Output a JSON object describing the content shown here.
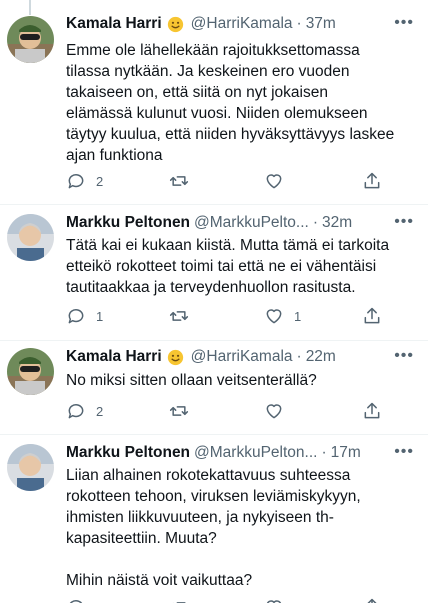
{
  "tweets": [
    {
      "name": "Kamala Harri",
      "handle": "@HarriKamala",
      "time": "37m",
      "text": "Emme ole lähellekään rajoitukksettomassa\ntilassa nytkään. Ja keskeinen ero vuoden\ntakaiseen on, että siitä on nyt jokaisen\nelämässä kulunut vuosi. Niiden olemukseen\ntäytyy kuulua, että niiden hyväksyttävyys laskee\najan funktiona",
      "replies": "2",
      "retweets": "",
      "likes": "",
      "has_emoji": true
    },
    {
      "name": "Markku Peltonen",
      "handle": "@MarkkuPelto...",
      "time": "32m",
      "text": "Tätä kai ei kukaan kiistä. Mutta tämä ei tarkoita\netteikö rokotteet toimi tai että ne ei vähentäisi\ntautitaakkaa ja terveydenhuollon rasitusta.",
      "replies": "1",
      "retweets": "",
      "likes": "1",
      "has_emoji": false
    },
    {
      "name": "Kamala Harri",
      "handle": "@HarriKamala",
      "time": "22m",
      "text": "No miksi sitten ollaan veitsenterällä?",
      "replies": "2",
      "retweets": "",
      "likes": "",
      "has_emoji": true
    },
    {
      "name": "Markku Peltonen",
      "handle": "@MarkkuPelton...",
      "time": "17m",
      "text": "Liian alhainen rokotekattavuus suhteessa\nrokotteen tehoon, viruksen leviämiskykyyn,\nihmisten liikkuvuuteen, ja nykyiseen th-\nkapasiteettiin. Muuta?\n\nMihin näistä voit vaikuttaa?",
      "replies": "",
      "retweets": "",
      "likes": "",
      "has_emoji": false
    }
  ],
  "ui": {
    "more_glyph": "•••",
    "separator": "·",
    "colors": {
      "text": "#0f1419",
      "secondary": "#536471",
      "divider": "#eff3f4"
    }
  },
  "icons": [
    "reply-icon",
    "retweet-icon",
    "like-icon",
    "share-icon",
    "more-icon",
    "smiley-emoji-icon"
  ]
}
